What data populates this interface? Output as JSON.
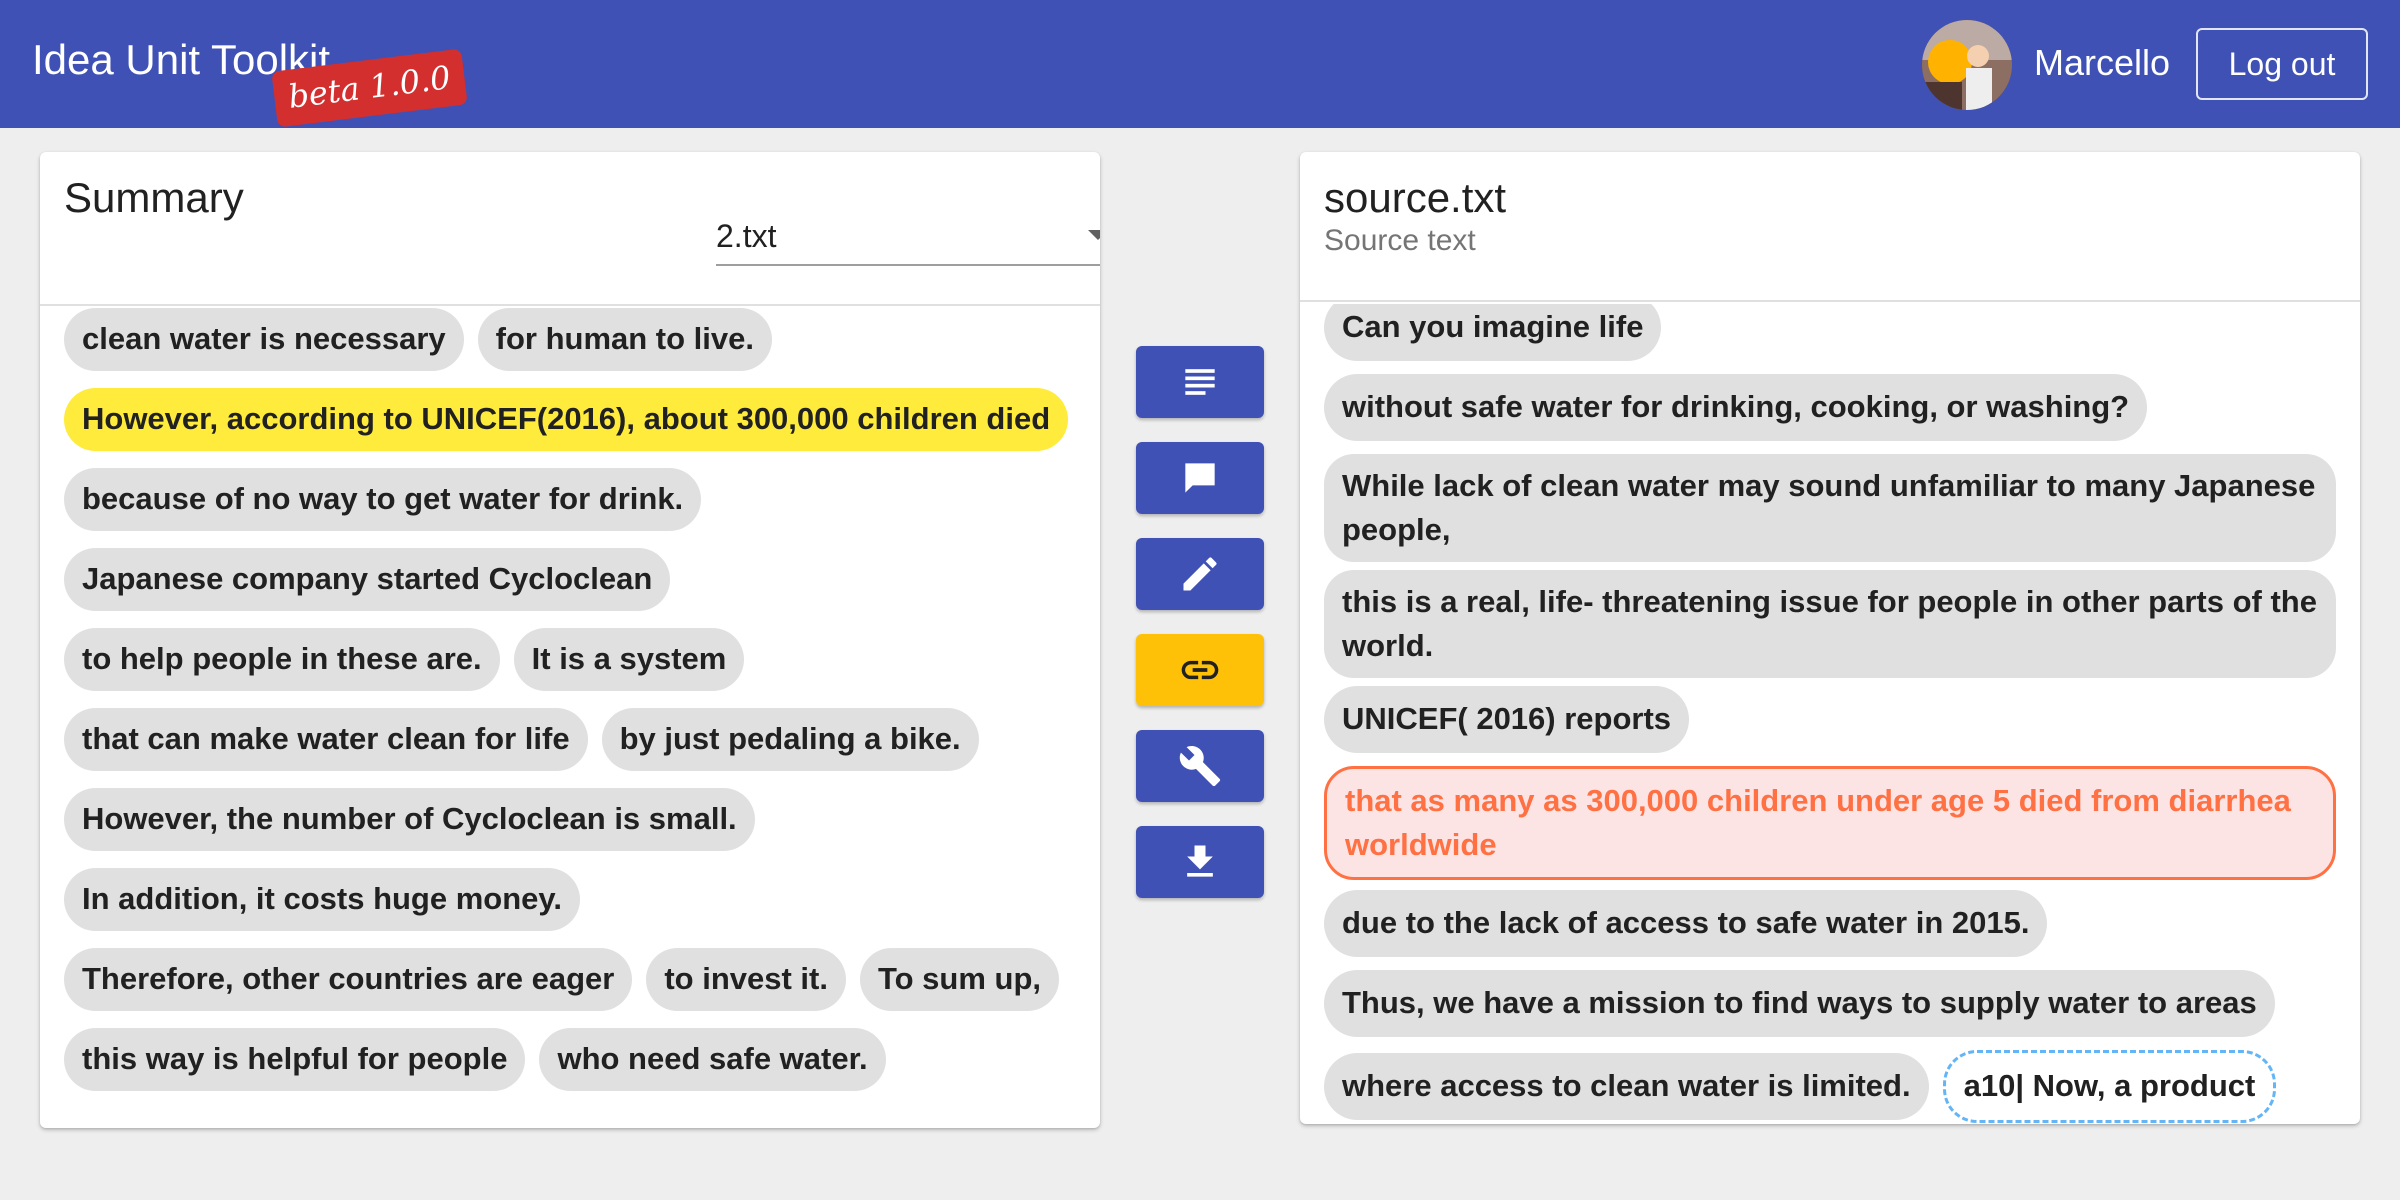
{
  "header": {
    "app_title": "Idea Unit Toolkit",
    "beta_label": "beta 1.0.0",
    "username": "Marcello",
    "logout_label": "Log out",
    "bar_color": "#3f51b5"
  },
  "summary": {
    "title": "Summary",
    "file_select": {
      "value": "2.txt"
    },
    "rows": [
      [
        "clean water is necessary",
        "for human to live."
      ],
      [
        "However, according to UNICEF(2016), about 300,000 children died"
      ],
      [
        "because of no way to get water for drink."
      ],
      [
        "Japanese company started Cycloclean"
      ],
      [
        "to help people in these are.",
        "It is a system"
      ],
      [
        "that can make water clean for life",
        "by just pedaling a bike."
      ],
      [
        "However, the number of Cycloclean is small."
      ],
      [
        "In addition, it costs huge money."
      ],
      [
        "Therefore, other countries are eager",
        "to invest it.",
        "To sum up,"
      ],
      [
        "this way is helpful for people",
        "who need safe water."
      ]
    ],
    "highlight_color": "#ffeb3b"
  },
  "tools": [
    {
      "name": "text-lines-icon",
      "active": false
    },
    {
      "name": "comment-icon",
      "active": false
    },
    {
      "name": "pencil-icon",
      "active": false
    },
    {
      "name": "link-icon",
      "active": true
    },
    {
      "name": "wrench-icon",
      "active": false
    },
    {
      "name": "download-icon",
      "active": false
    }
  ],
  "source": {
    "title": "source.txt",
    "subtitle": "Source text",
    "units": [
      "Can you imagine life",
      "without safe water for drinking, cooking, or washing?",
      "While lack of clean water may sound unfamiliar to many Japanese people,",
      "this is a real, life- threatening issue for people in other parts of the world.",
      "UNICEF( 2016) reports",
      "that as many as 300,000 children under age 5 died from diarrhea worldwide",
      "due to the lack of access to safe water in 2015.",
      "Thus, we have a mission to find ways to supply water to areas",
      "where access to clean water is limited.",
      "a10| Now, a product"
    ],
    "linked_color": "#ff7043",
    "pending_color": "#64b5f6"
  }
}
